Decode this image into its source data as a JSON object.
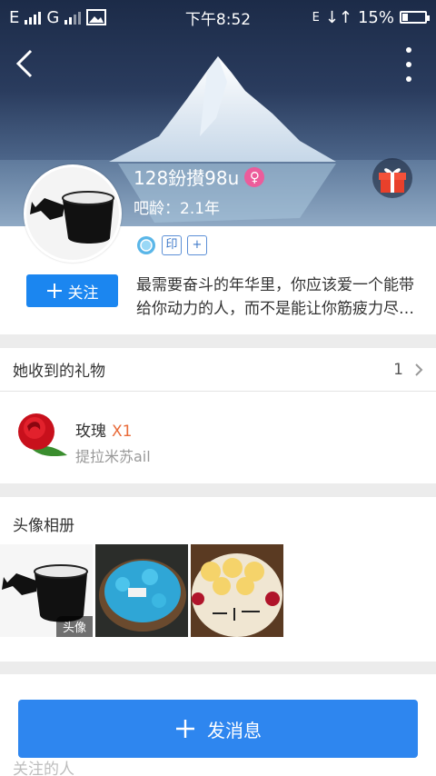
{
  "status_bar": {
    "carrier1": "E",
    "carrier2": "G",
    "time": "下午8:52",
    "network": "E",
    "battery": "15%"
  },
  "profile": {
    "username": "128鈖攅98u",
    "gender_symbol": "♀",
    "bar_age": "吧龄：2.1年",
    "badge_print": "印",
    "badge_add": "+",
    "follow_label": "关注",
    "bio": "最需要奋斗的年华里，你应该爱一个能带给你动力的人，而不是能让你筋疲力尽的人"
  },
  "gifts": {
    "title": "她收到的礼物",
    "count": "1",
    "items": [
      {
        "name": "玫瑰",
        "qty": "X1",
        "from": "提拉米苏ail"
      }
    ]
  },
  "album": {
    "title": "头像相册",
    "avatar_tag": "头像",
    "photos": [
      "mug",
      "cake",
      "family"
    ]
  },
  "following": {
    "title": "关注的人"
  },
  "actions": {
    "send_message": "发消息"
  },
  "colors": {
    "accent": "#1b86f0",
    "send": "#2e86ef",
    "gender": "#ec5c9b",
    "gift_qty": "#e96b3a"
  }
}
